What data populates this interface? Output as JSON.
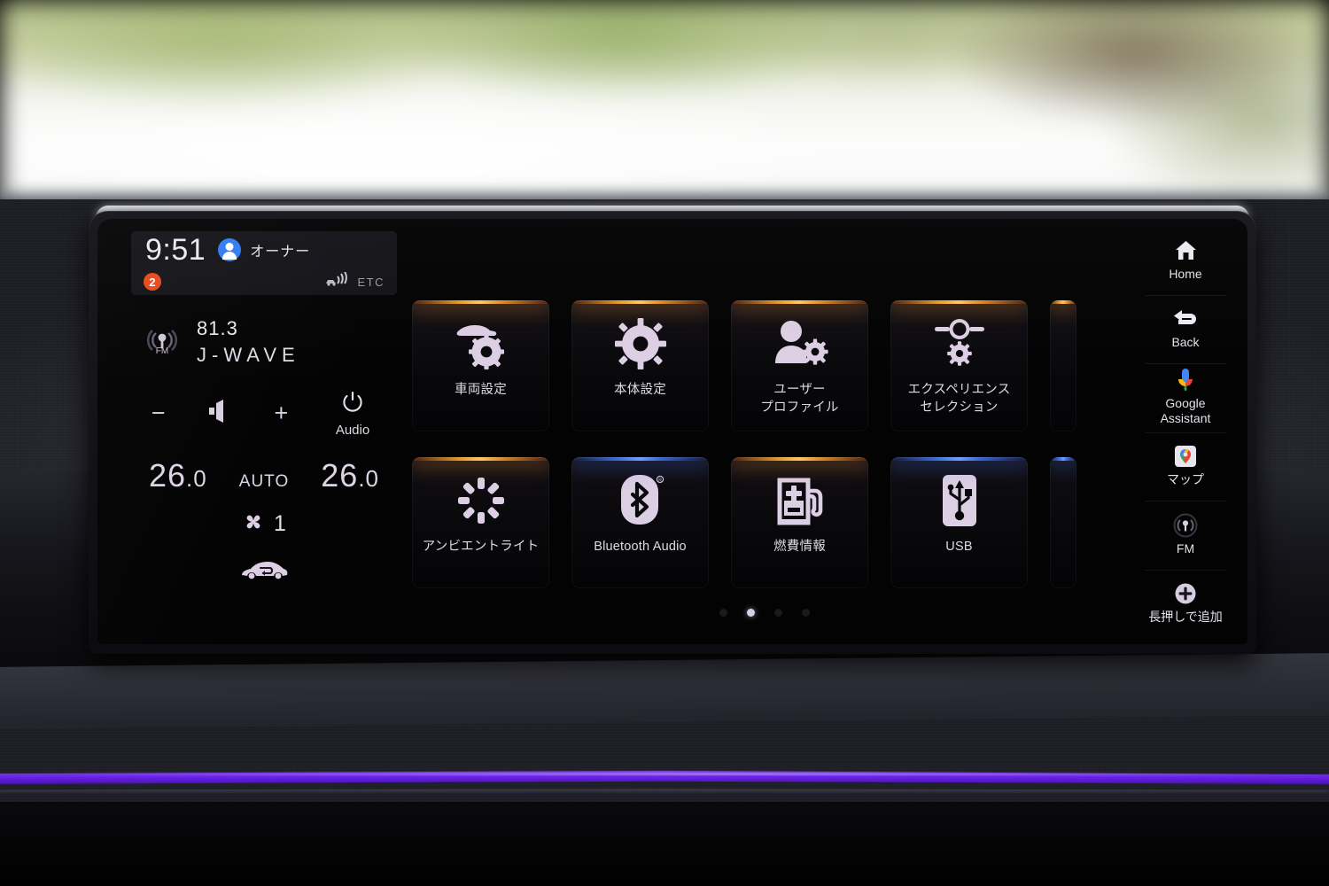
{
  "status": {
    "clock": "9:51",
    "profile_name": "オーナー",
    "notification_count": "2",
    "etc_label": "ETC"
  },
  "radio": {
    "frequency": "81.3",
    "station": "J-WAVE",
    "band_icon_label": "FM",
    "volume_down": "−",
    "volume_up": "+",
    "power_label": "Audio"
  },
  "climate": {
    "temp_left_int": "26",
    "temp_left_dec": ".0",
    "temp_right_int": "26",
    "temp_right_dec": ".0",
    "mode": "AUTO",
    "fan_speed": "1"
  },
  "tiles": {
    "row1": [
      {
        "label": "車両設定",
        "icon": "car-gear-icon",
        "glow": "orange"
      },
      {
        "label": "本体設定",
        "icon": "gear-icon",
        "glow": "orange"
      },
      {
        "label": "ユーザー\nプロファイル",
        "icon": "person-gear-icon",
        "glow": "orange"
      },
      {
        "label": "エクスペリエンス\nセレクション",
        "icon": "slider-gear-icon",
        "glow": "orange"
      }
    ],
    "row2": [
      {
        "label": "アンビエントライト",
        "icon": "ambient-light-icon",
        "glow": "orange"
      },
      {
        "label": "Bluetooth Audio",
        "icon": "bluetooth-icon",
        "glow": "blue"
      },
      {
        "label": "燃費情報",
        "icon": "fuel-pump-icon",
        "glow": "orange"
      },
      {
        "label": "USB",
        "icon": "usb-icon",
        "glow": "blue"
      }
    ]
  },
  "pagination": {
    "total": 4,
    "active_index": 1
  },
  "sidebar": {
    "items": [
      {
        "label": "Home",
        "icon": "home-icon"
      },
      {
        "label": "Back",
        "icon": "back-arrow-icon"
      },
      {
        "label": "Google\nAssistant",
        "icon": "google-assistant-mic-icon"
      },
      {
        "label": "マップ",
        "icon": "google-maps-pin-icon"
      },
      {
        "label": "FM",
        "icon": "fm-radio-icon"
      },
      {
        "label": "長押しで追加",
        "icon": "plus-circle-icon"
      }
    ]
  },
  "colors": {
    "glow_orange": "#e89a2a",
    "glow_blue": "#3b6fe0",
    "accent_blue": "#2f7cf6",
    "notification_orange": "#e8491b",
    "ambient_purple": "#6a22e8",
    "icon_lavender": "#dccfe4"
  }
}
